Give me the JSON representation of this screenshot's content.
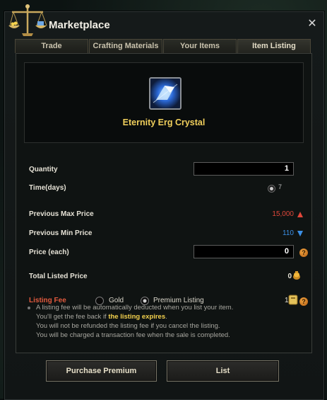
{
  "window": {
    "title": "Marketplace",
    "close_symbol": "✕"
  },
  "tabs": [
    {
      "label": "Trade",
      "active": false
    },
    {
      "label": "Crafting Materials",
      "active": false
    },
    {
      "label": "Your Items",
      "active": false
    },
    {
      "label": "Item Listing",
      "active": true
    }
  ],
  "item": {
    "name": "Eternity Erg Crystal",
    "name_color": "#f0cf5c"
  },
  "form": {
    "quantity_label": "Quantity",
    "quantity_value": "1",
    "time_label": "Time(days)",
    "time_value": "7",
    "prev_max_label": "Previous Max Price",
    "prev_max_value": "15,000",
    "prev_max_color": "#e0473a",
    "prev_min_label": "Previous Min Price",
    "prev_min_value": "110",
    "prev_min_color": "#3b8fe6",
    "price_label": "Price (each)",
    "price_value": "0",
    "total_label": "Total Listed Price",
    "total_value": "0",
    "fee_label": "Listing Fee",
    "fee_label_color": "#e25a3e",
    "fee_option_gold": "Gold",
    "fee_option_premium": "Premium Listing",
    "fee_selected": "Premium Listing",
    "fee_value": "1"
  },
  "notes": {
    "line1": "A listing fee will be automatically deducted when you list your item.",
    "line2_prefix": "You'll get the fee back if ",
    "line2_highlight": "the listing expires",
    "line2_suffix": ".",
    "line3": "You will not be refunded the listing fee if you cancel the listing.",
    "line4": "You will be charged a transaction fee when the sale is completed."
  },
  "buttons": {
    "premium": "Purchase Premium",
    "list": "List"
  },
  "icons": {
    "title": "scale-icon",
    "close": "close-icon",
    "item": "erg-crystal-icon",
    "help": "help-icon",
    "gold": "gold-coin-icon",
    "premium_ticket": "premium-ticket-icon"
  },
  "colors": {
    "gold_text": "#f0cf5c",
    "highlight": "#f4d24e",
    "up_arrow": "#e0473a",
    "down_arrow": "#3b8fe6"
  }
}
